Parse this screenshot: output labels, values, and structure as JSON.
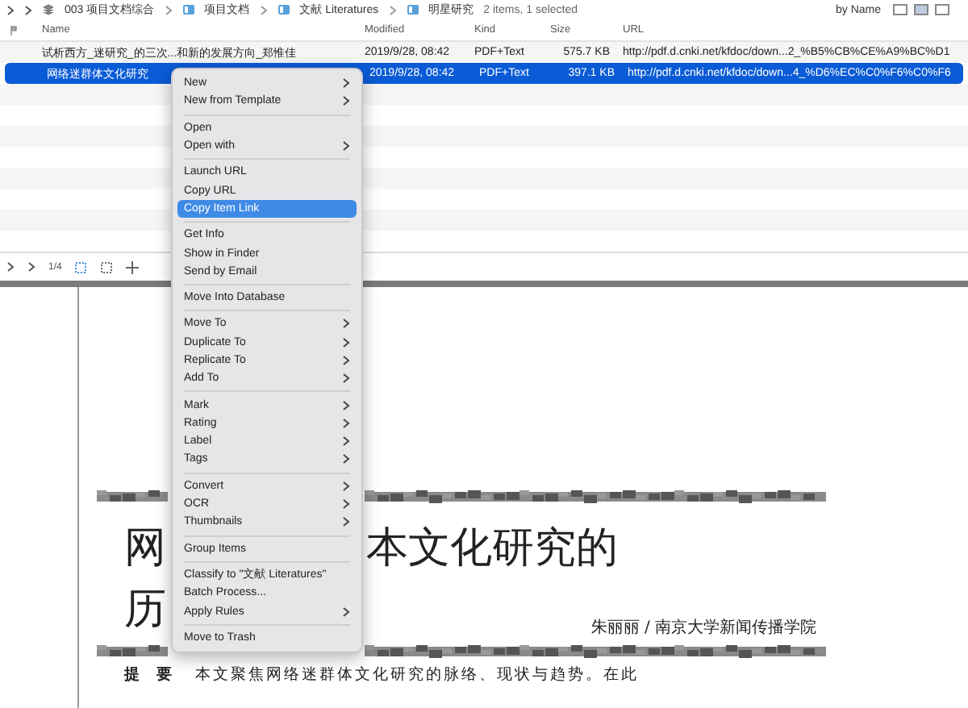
{
  "breadcrumb": {
    "items": [
      {
        "label": "003 项目文档综合",
        "kind": "database"
      },
      {
        "label": "项目文档",
        "kind": "folder"
      },
      {
        "label": "文献 Literatures",
        "kind": "folder"
      },
      {
        "label": "明星研究",
        "kind": "folder"
      }
    ],
    "status": "2 items, 1 selected",
    "sort": "by Name"
  },
  "table": {
    "columns": [
      "Name",
      "Modified",
      "Kind",
      "Size",
      "URL"
    ],
    "rows": [
      {
        "name": "试析西方_迷研究_的三次...和新的发展方向_郑惟佳",
        "modified": "2019/9/28, 08:42",
        "kind": "PDF+Text",
        "size": "575.7 KB",
        "url": "http://pdf.d.cnki.net/kfdoc/down...2_%B5%CB%CE%A9%BC%D1",
        "selected": false
      },
      {
        "name": "网络迷群体文化研究",
        "modified": "2019/9/28, 08:42",
        "kind": "PDF+Text",
        "size": "397.1 KB",
        "url": "http://pdf.d.cnki.net/kfdoc/down...4_%D6%EC%C0%F6%C0%F6",
        "selected": true
      }
    ]
  },
  "pdf_toolbar": {
    "page": "1/4"
  },
  "document": {
    "title_line_1_left": "网",
    "title_line_1_right": "本文化研究的",
    "title_line_2_left": "历",
    "author": "朱丽丽 / 南京大学新闻传播学院",
    "abstract_label": "提　要",
    "abstract": "本文聚焦网络迷群体文化研究的脉络、现状与趋势。在此"
  },
  "context_menu": {
    "groups": [
      [
        {
          "label": "New",
          "submenu": true,
          "selected": false
        },
        {
          "label": "New from Template",
          "submenu": true,
          "selected": false
        }
      ],
      [
        {
          "label": "Open",
          "submenu": false,
          "selected": false
        },
        {
          "label": "Open with",
          "submenu": true,
          "selected": false
        }
      ],
      [
        {
          "label": "Launch URL",
          "submenu": false,
          "selected": false
        },
        {
          "label": "Copy URL",
          "submenu": false,
          "selected": false
        },
        {
          "label": "Copy Item Link",
          "submenu": false,
          "selected": true
        }
      ],
      [
        {
          "label": "Get Info",
          "submenu": false,
          "selected": false
        },
        {
          "label": "Show in Finder",
          "submenu": false,
          "selected": false
        },
        {
          "label": "Send by Email",
          "submenu": false,
          "selected": false
        }
      ],
      [
        {
          "label": "Move Into Database",
          "submenu": false,
          "selected": false
        }
      ],
      [
        {
          "label": "Move To",
          "submenu": true,
          "selected": false
        },
        {
          "label": "Duplicate To",
          "submenu": true,
          "selected": false
        },
        {
          "label": "Replicate To",
          "submenu": true,
          "selected": false
        },
        {
          "label": "Add To",
          "submenu": true,
          "selected": false
        }
      ],
      [
        {
          "label": "Mark",
          "submenu": true,
          "selected": false
        },
        {
          "label": "Rating",
          "submenu": true,
          "selected": false
        },
        {
          "label": "Label",
          "submenu": true,
          "selected": false
        },
        {
          "label": "Tags",
          "submenu": true,
          "selected": false
        }
      ],
      [
        {
          "label": "Convert",
          "submenu": true,
          "selected": false
        },
        {
          "label": "OCR",
          "submenu": true,
          "selected": false
        },
        {
          "label": "Thumbnails",
          "submenu": true,
          "selected": false
        }
      ],
      [
        {
          "label": "Group Items",
          "submenu": false,
          "selected": false
        }
      ],
      [
        {
          "label": "Classify to \"文献 Literatures\"",
          "submenu": false,
          "selected": false
        },
        {
          "label": "Batch Process...",
          "submenu": false,
          "selected": false
        },
        {
          "label": "Apply Rules",
          "submenu": true,
          "selected": false
        }
      ],
      [
        {
          "label": "Move to Trash",
          "submenu": false,
          "selected": false
        }
      ]
    ]
  }
}
